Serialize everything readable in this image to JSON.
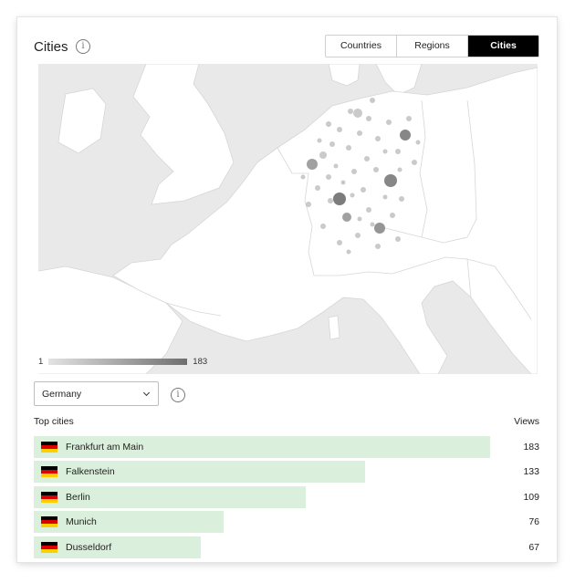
{
  "title": "Cities",
  "info_icon": "info-icon",
  "tabs": [
    {
      "label": "Countries",
      "active": false
    },
    {
      "label": "Regions",
      "active": false
    },
    {
      "label": "Cities",
      "active": true
    }
  ],
  "legend": {
    "min": "1",
    "max": "183"
  },
  "country_select": {
    "value": "Germany"
  },
  "list": {
    "header_left": "Top cities",
    "header_right": "Views",
    "max_value": 183,
    "flag_icon": "germany-flag-icon",
    "rows": [
      {
        "name": "Frankfurt am Main",
        "value": 183
      },
      {
        "name": "Falkenstein",
        "value": 133
      },
      {
        "name": "Berlin",
        "value": 109
      },
      {
        "name": "Munich",
        "value": 76
      },
      {
        "name": "Dusseldorf",
        "value": 67
      }
    ]
  },
  "colors": {
    "bar_fill": "#dbf0dc",
    "active_tab": "#000000",
    "map_water": "#e9e9e9"
  }
}
